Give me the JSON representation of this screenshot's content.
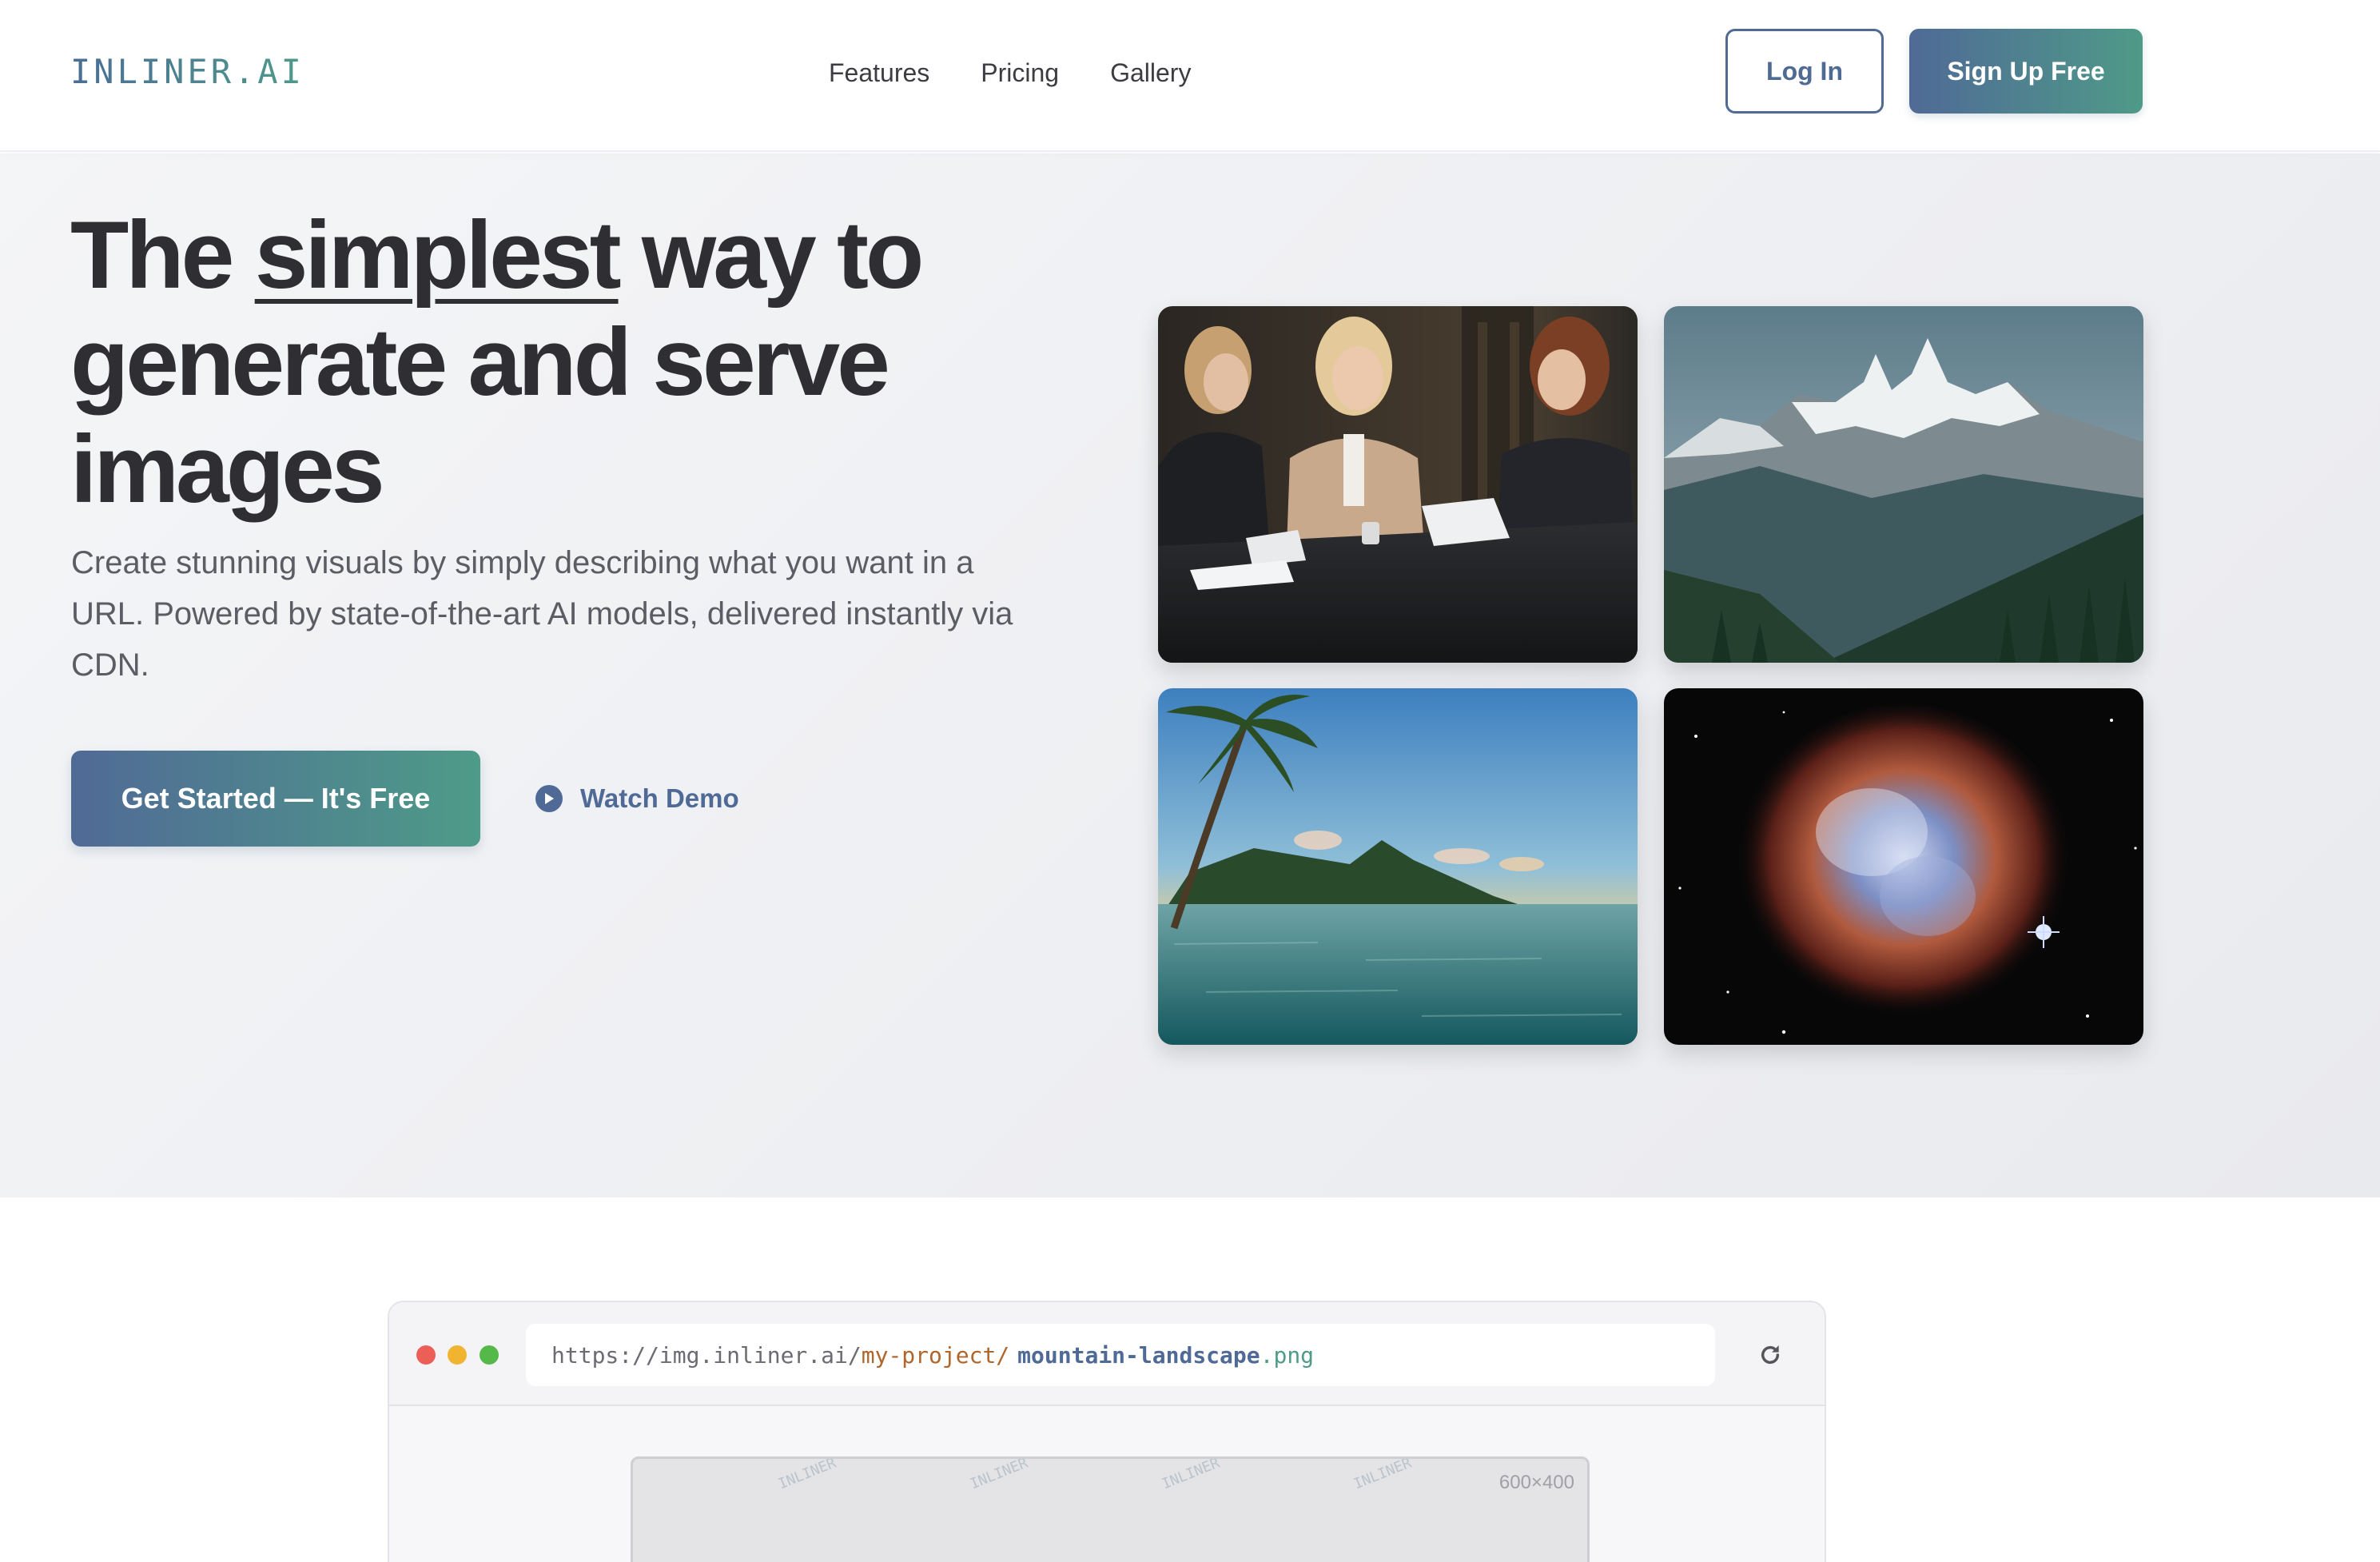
{
  "nav": {
    "logo": "INLINER.AI",
    "links": [
      "Features",
      "Pricing",
      "Gallery"
    ],
    "login_label": "Log In",
    "signup_label": "Sign Up Free"
  },
  "hero": {
    "headline_before": "The ",
    "headline_emphasis": "simplest",
    "headline_after": " way to generate and serve images",
    "subtext": "Create stunning visuals by simply describing what you want in a URL. Powered by state-of-the-art AI models, delivered instantly via CDN.",
    "primary_cta": "Get Started — It's Free",
    "secondary_cta": "Watch Demo"
  },
  "gallery": {
    "images": [
      "business-meeting-photo",
      "mountain-landscape-photo",
      "tropical-beach-photo",
      "nebula-space-photo"
    ]
  },
  "browser": {
    "url_base": "https://img.inliner.ai/",
    "url_project": "my-project/",
    "url_name": "mountain-landscape",
    "url_ext": ".png",
    "watermark": "INLINER",
    "preview_size": "600×400"
  },
  "colors": {
    "brand_blue": "#4f6a96",
    "brand_teal": "#4e9b88",
    "text_dark": "#2f2f33",
    "text_muted": "#5c5c64"
  }
}
